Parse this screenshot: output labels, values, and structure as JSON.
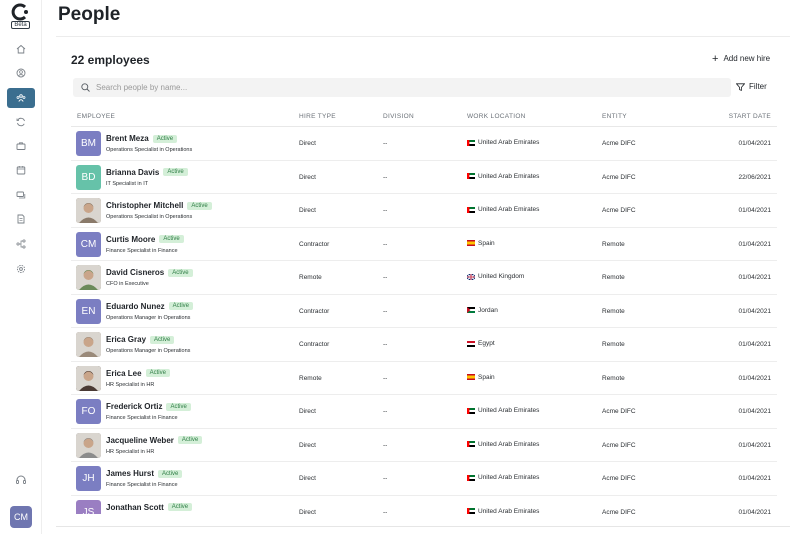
{
  "app": {
    "beta_label": "Beta",
    "user_initials": "CM"
  },
  "header": {
    "title": "People",
    "count_title": "22 employees",
    "add_new_hire": "Add new hire"
  },
  "search": {
    "placeholder": "Search people by name...",
    "filter_label": "Filter"
  },
  "table": {
    "columns": [
      "EMPLOYEE",
      "HIRE TYPE",
      "DIVISION",
      "WORK LOCATION",
      "ENTITY",
      "START DATE"
    ],
    "rows": [
      {
        "initials": "BM",
        "avatar_color": "#7b7ec2",
        "photo": false,
        "name": "Brent Meza",
        "status": "Active",
        "role": "Operations Specialist in Operations",
        "hire_type": "Direct",
        "division": "--",
        "location": "United Arab Emirates",
        "flag": "uae",
        "entity": "Acme DIFC",
        "start_date": "01/04/2021"
      },
      {
        "initials": "BD",
        "avatar_color": "#66c2a9",
        "photo": false,
        "name": "Brianna Davis",
        "status": "Active",
        "role": "IT Specialist in IT",
        "hire_type": "Direct",
        "division": "--",
        "location": "United Arab Emirates",
        "flag": "uae",
        "entity": "Acme DIFC",
        "start_date": "22/06/2021"
      },
      {
        "initials": "",
        "avatar_color": "#8a7a6a",
        "photo": true,
        "name": "Christopher Mitchell",
        "status": "Active",
        "role": "Operations Specialist in Operations",
        "hire_type": "Direct",
        "division": "--",
        "location": "United Arab Emirates",
        "flag": "uae",
        "entity": "Acme DIFC",
        "start_date": "01/04/2021"
      },
      {
        "initials": "CM",
        "avatar_color": "#7b7ec2",
        "photo": false,
        "name": "Curtis Moore",
        "status": "Active",
        "role": "Finance Specialist in Finance",
        "hire_type": "Contractor",
        "division": "--",
        "location": "Spain",
        "flag": "spain",
        "entity": "Remote",
        "start_date": "01/04/2021"
      },
      {
        "initials": "",
        "avatar_color": "#6b8a5a",
        "photo": true,
        "name": "David Cisneros",
        "status": "Active",
        "role": "CFO in Executive",
        "hire_type": "Remote",
        "division": "--",
        "location": "United Kingdom",
        "flag": "uk",
        "entity": "Remote",
        "start_date": "01/04/2021"
      },
      {
        "initials": "EN",
        "avatar_color": "#7b7ec2",
        "photo": false,
        "name": "Eduardo Nunez",
        "status": "Active",
        "role": "Operations Manager in Operations",
        "hire_type": "Contractor",
        "division": "--",
        "location": "Jordan",
        "flag": "jordan",
        "entity": "Remote",
        "start_date": "01/04/2021"
      },
      {
        "initials": "",
        "avatar_color": "#9a8a7a",
        "photo": true,
        "name": "Erica Gray",
        "status": "Active",
        "role": "Operations Manager in Operations",
        "hire_type": "Contractor",
        "division": "--",
        "location": "Egypt",
        "flag": "egypt",
        "entity": "Remote",
        "start_date": "01/04/2021"
      },
      {
        "initials": "",
        "avatar_color": "#4a3a34",
        "photo": true,
        "name": "Erica Lee",
        "status": "Active",
        "role": "HR Specialist in HR",
        "hire_type": "Remote",
        "division": "--",
        "location": "Spain",
        "flag": "spain",
        "entity": "Remote",
        "start_date": "01/04/2021"
      },
      {
        "initials": "FO",
        "avatar_color": "#7b7ec2",
        "photo": false,
        "name": "Frederick Ortiz",
        "status": "Active",
        "role": "Finance Specialist in Finance",
        "hire_type": "Direct",
        "division": "--",
        "location": "United Arab Emirates",
        "flag": "uae",
        "entity": "Acme DIFC",
        "start_date": "01/04/2021"
      },
      {
        "initials": "",
        "avatar_color": "#8c8c8c",
        "photo": true,
        "name": "Jacqueline Weber",
        "status": "Active",
        "role": "HR Specialist in HR",
        "hire_type": "Direct",
        "division": "--",
        "location": "United Arab Emirates",
        "flag": "uae",
        "entity": "Acme DIFC",
        "start_date": "01/04/2021"
      },
      {
        "initials": "JH",
        "avatar_color": "#7b7ec2",
        "photo": false,
        "name": "James Hurst",
        "status": "Active",
        "role": "Finance Specialist in Finance",
        "hire_type": "Direct",
        "division": "--",
        "location": "United Arab Emirates",
        "flag": "uae",
        "entity": "Acme DIFC",
        "start_date": "01/04/2021"
      },
      {
        "initials": "JS",
        "avatar_color": "#9a7ec2",
        "photo": false,
        "name": "Jonathan Scott",
        "status": "Active",
        "role": "",
        "hire_type": "Direct",
        "division": "--",
        "location": "United Arab Emirates",
        "flag": "uae",
        "entity": "Acme DIFC",
        "start_date": "01/04/2021"
      }
    ]
  },
  "nav": {
    "icons": [
      "home-icon",
      "user-circle-icon",
      "people-icon",
      "sync-icon",
      "briefcase-icon",
      "calendar-icon",
      "chat-icon",
      "document-icon",
      "org-chart-icon",
      "settings-icon"
    ],
    "active_index": 2,
    "accent": "#3b6e8f"
  }
}
